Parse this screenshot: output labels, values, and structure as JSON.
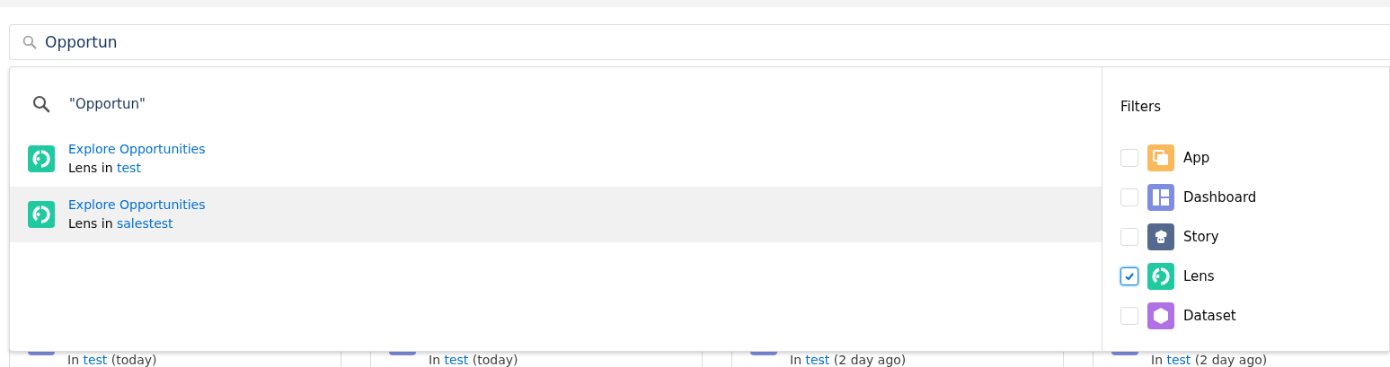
{
  "search": {
    "value": "Opportun"
  },
  "dropdown": {
    "query_suggestion": "\"Opportun\"",
    "results": [
      {
        "title": "Explore Opportunities",
        "type_label": "Lens in",
        "folder": "test",
        "kind": "lens",
        "selected": false
      },
      {
        "title": "Explore Opportunities",
        "type_label": "Lens in",
        "folder": "salestest",
        "kind": "lens",
        "selected": true
      }
    ],
    "filters": {
      "title": "Filters",
      "items": [
        {
          "label": "App",
          "kind": "app",
          "checked": false
        },
        {
          "label": "Dashboard",
          "kind": "dashboard",
          "checked": false
        },
        {
          "label": "Story",
          "kind": "story",
          "checked": false
        },
        {
          "label": "Lens",
          "kind": "lens",
          "checked": true
        },
        {
          "label": "Dataset",
          "kind": "dataset",
          "checked": false
        }
      ]
    }
  },
  "cards": [
    {
      "prefix": "In",
      "folder": "test",
      "time": "(today)"
    },
    {
      "prefix": "In",
      "folder": "test",
      "time": "(today)"
    },
    {
      "prefix": "In",
      "folder": "test",
      "time": "(2 day ago)"
    },
    {
      "prefix": "In",
      "folder": "test",
      "time": "(2 day ago)"
    }
  ]
}
